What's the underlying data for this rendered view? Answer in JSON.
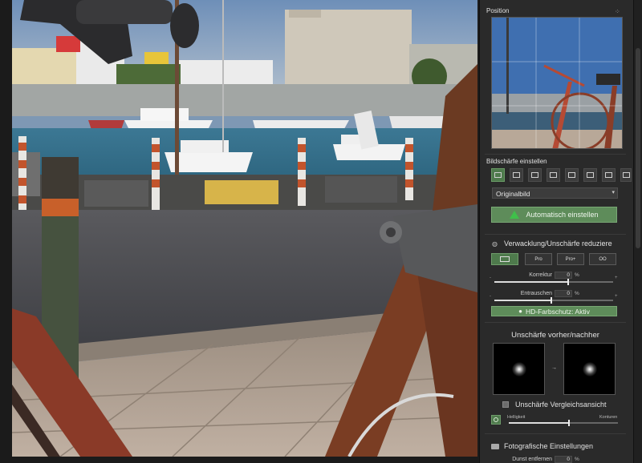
{
  "position": {
    "title": "Position",
    "expand_icon": "expand-icon"
  },
  "sharpness": {
    "title": "Bildschärfe einstellen",
    "toolbar_icons": [
      "image-icon",
      "camera-icon",
      "wave-icon",
      "face-icon",
      "drop-icon",
      "pin-icon",
      "mountain-icon",
      "frame-icon"
    ],
    "preset_value": "Originalbild",
    "auto_button": "Automatisch einstellen"
  },
  "shake": {
    "title": "Verwacklung/Unschärfe reduziere",
    "modes": [
      "",
      "Pro",
      "Pro+",
      "OO"
    ],
    "correction_label": "Korrektur",
    "correction_value": "0",
    "correction_unit": "%",
    "correction_level": 0.62,
    "denoise_label": "Entrauschen",
    "denoise_value": "0",
    "denoise_unit": "%",
    "denoise_level": 0.48,
    "hd_label": "HD-Farbschutz: Aktiv"
  },
  "blur_compare": {
    "title": "Unschärfe vorher/nachher",
    "arrow": "→",
    "compare_label": "Unschärfe Vergleichsansicht",
    "brightness_label": "Helligkeit",
    "contour_label": "Konturen",
    "brightness_level": 0.55
  },
  "photo": {
    "title": "Fotografische Einstellungen",
    "haze_label": "Dunst entfernen",
    "haze_value": "0",
    "haze_unit": "%"
  },
  "colors": {
    "accent_green": "#5e8c5a",
    "panel_bg": "#2a2a2a"
  }
}
